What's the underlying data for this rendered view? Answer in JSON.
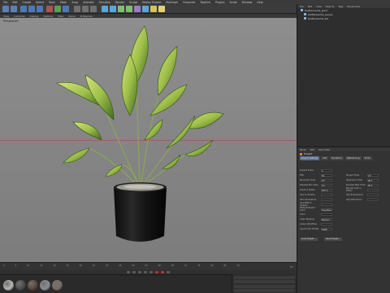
{
  "menubar": {
    "items": [
      "File",
      "Edit",
      "Create",
      "Select",
      "Tools",
      "Mesh",
      "Snap",
      "Animate",
      "Simulate",
      "Render",
      "Sculpt",
      "Motion Tracker",
      "MoGraph",
      "Character",
      "Pipeline",
      "Plugins",
      "Script",
      "Window",
      "Help"
    ]
  },
  "viewport": {
    "menu": [
      "View",
      "Cameras",
      "Display",
      "Options",
      "Filter",
      "Panel",
      "ProRender"
    ],
    "label": "Perspective"
  },
  "timeline": {
    "ticks": [
      "0",
      "5",
      "10",
      "15",
      "20",
      "25",
      "30",
      "35",
      "40",
      "45",
      "50",
      "55",
      "60",
      "65",
      "70",
      "75",
      "80",
      "85",
      "90"
    ],
    "end_label": "0 F"
  },
  "materials": {
    "colors": [
      "#b9b7b3",
      "#4a4a4a",
      "#5b4638",
      "#8a8f92",
      "#7a6c60"
    ]
  },
  "object_manager": {
    "menu": [
      "File",
      "Edit",
      "View",
      "Objects",
      "Tags",
      "Bookmarks"
    ],
    "items": [
      "Dieffenbachia_plant",
      "Dieffenbachia_Leaves",
      "Dieffenbachia_Pot"
    ]
  },
  "attribute_manager": {
    "menu": [
      "Mode",
      "Edit",
      "User Data"
    ],
    "title": "Project",
    "tabs": [
      "Project Settings",
      "Info",
      "Dynamics",
      "Referencing",
      "To Do"
    ],
    "rows": [
      {
        "label": "Project Scale",
        "value": "1"
      },
      {
        "label": "FPS",
        "value": "30"
      },
      {
        "label": "Minimum Time",
        "value": "0 F"
      },
      {
        "label": "Preview Min Time",
        "value": "0 F"
      },
      {
        "label": "Level of Detail",
        "value": "100 %"
      },
      {
        "label": "Use Animation",
        "value": ""
      },
      {
        "label": "Use Generators",
        "value": ""
      },
      {
        "label": "Use Motion System",
        "value": ""
      },
      {
        "label": "Default Object Color",
        "value": "Gray-Blue"
      },
      {
        "label": "Color",
        "value": ""
      },
      {
        "label": "View Clipping",
        "value": "Medium"
      },
      {
        "label": "Linear Workflow",
        "value": ""
      },
      {
        "label": "Input Color Profile",
        "value": "sRGB"
      }
    ],
    "right_rows": [
      {
        "label": "Project Time",
        "value": "0 F"
      },
      {
        "label": "Maximum Time",
        "value": "90 F"
      },
      {
        "label": "Preview Max Time",
        "value": "90 F"
      },
      {
        "label": "Render LOD in Editor",
        "value": ""
      },
      {
        "label": "Use Expressions",
        "value": ""
      },
      {
        "label": "Use Deformers",
        "value": ""
      }
    ],
    "buttons": [
      "Load Preset...",
      "Save Preset..."
    ]
  },
  "colors": {
    "leaf_dark": "#3f6b1e",
    "leaf_light": "#c8d872",
    "pot": "#161616",
    "accent": "#5a6f90"
  }
}
